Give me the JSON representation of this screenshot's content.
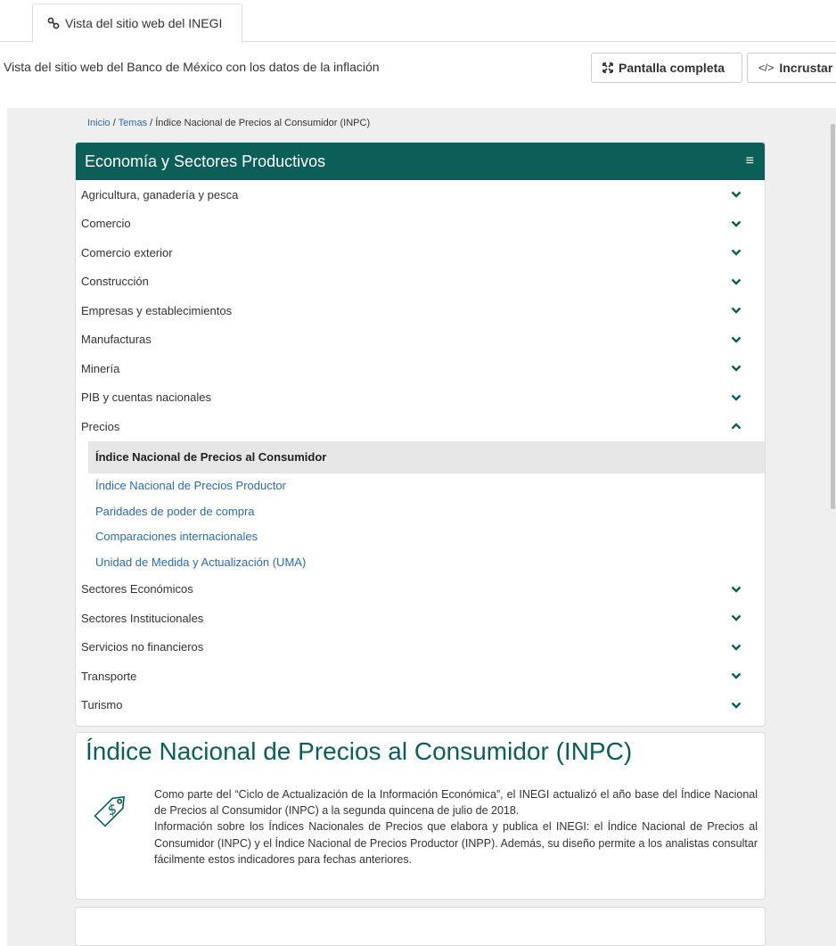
{
  "tab": {
    "label": "Vista del sitio web del INEGI",
    "icon": "link-icon"
  },
  "description": "Vista del sitio web del Banco de México con los datos de la inflación",
  "buttons": {
    "fullscreen": {
      "label": "Pantalla completa",
      "icon": "expand-icon"
    },
    "embed": {
      "label": "Incrustar",
      "icon": "code-icon",
      "glyph": "</>"
    }
  },
  "breadcrumb": {
    "home": "Inicio",
    "sep1": " / ",
    "topics": "Temas",
    "sep2": " / ",
    "current": "Índice Nacional de Precios al Consumidor (INPC)"
  },
  "menu": {
    "title": "Economía y Sectores Productivos",
    "menu_icon": "≡",
    "items_before": [
      "Agricultura, ganadería y pesca",
      "Comercio",
      "Comercio exterior",
      "Construcción",
      "Empresas y establecimientos",
      "Manufacturas",
      "Minería",
      "PIB y cuentas nacionales"
    ],
    "expanded_item": "Precios",
    "sub_active": "Índice Nacional de Precios al Consumidor",
    "sub_links": [
      "Índice Nacional de Precios Productor",
      "Paridades de poder de compra",
      "Comparaciones internacionales",
      "Unidad de Medida y Actualización (UMA)"
    ],
    "items_after": [
      "Sectores Económicos",
      "Sectores Institucionales",
      "Servicios no financieros",
      "Transporte",
      "Turismo"
    ]
  },
  "info": {
    "title": "Índice Nacional de Precios al Consumidor (INPC)",
    "icon": "price-tag-icon",
    "paragraph1": "Como parte del “Ciclo de Actualización de la Información Económica”, el INEGI actualizó el año base del Índice Nacional de Precios al Consumidor (INPC) a la segunda quincena de julio de 2018.",
    "paragraph2": "Información sobre los Índices Nacionales de Precios que elabora y publica el INEGI: el Índice Nacional de Precios al Consumidor (INPC) y el Índice Nacional de Precios Productor (INPP). Además, su diseño permite a los analistas consultar fácilmente estos indicadores para fechas anteriores."
  },
  "colors": {
    "header_bg": "#0b5f58",
    "link": "#2b6cb0",
    "title": "#0b5f58",
    "chevron": "#0b5f58"
  }
}
